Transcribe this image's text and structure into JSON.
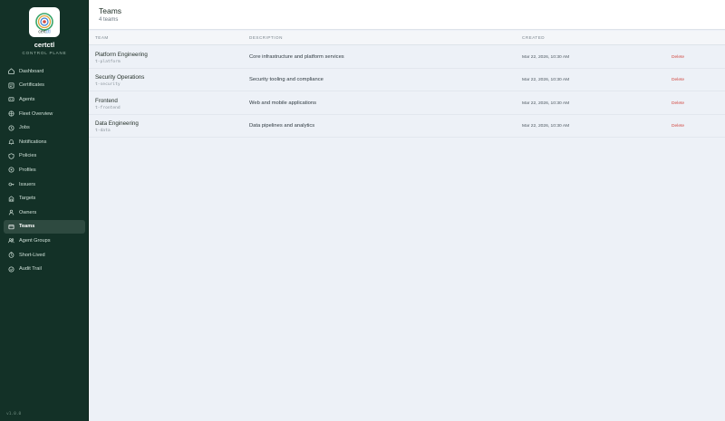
{
  "app": {
    "name": "certctl",
    "subtitle": "CONTROL PLANE",
    "logo_text": "cert",
    "logo_text_accent": "ctl",
    "version": "v1.0.0"
  },
  "sidebar": {
    "items": [
      {
        "label": "Dashboard",
        "icon": "home-icon",
        "active": false
      },
      {
        "label": "Certificates",
        "icon": "certificate-icon",
        "active": false
      },
      {
        "label": "Agents",
        "icon": "agent-icon",
        "active": false
      },
      {
        "label": "Fleet Overview",
        "icon": "fleet-icon",
        "active": false
      },
      {
        "label": "Jobs",
        "icon": "jobs-icon",
        "active": false
      },
      {
        "label": "Notifications",
        "icon": "bell-icon",
        "active": false
      },
      {
        "label": "Policies",
        "icon": "policy-icon",
        "active": false
      },
      {
        "label": "Profiles",
        "icon": "profile-icon",
        "active": false
      },
      {
        "label": "Issuers",
        "icon": "key-icon",
        "active": false
      },
      {
        "label": "Targets",
        "icon": "target-icon",
        "active": false
      },
      {
        "label": "Owners",
        "icon": "user-icon",
        "active": false
      },
      {
        "label": "Teams",
        "icon": "team-icon",
        "active": true
      },
      {
        "label": "Agent Groups",
        "icon": "group-icon",
        "active": false
      },
      {
        "label": "Short-Lived",
        "icon": "clock-icon",
        "active": false
      },
      {
        "label": "Audit Trail",
        "icon": "audit-icon",
        "active": false
      }
    ]
  },
  "header": {
    "title": "Teams",
    "subtitle": "4 teams"
  },
  "table": {
    "columns": [
      "TEAM",
      "DESCRIPTION",
      "CREATED"
    ],
    "delete_label": "Delete",
    "rows": [
      {
        "name": "Platform Engineering",
        "id": "t-platform",
        "description": "Core infrastructure and platform services",
        "created": "Mar 22, 2026, 10:30 AM"
      },
      {
        "name": "Security Operations",
        "id": "t-security",
        "description": "Security tooling and compliance",
        "created": "Mar 22, 2026, 10:30 AM"
      },
      {
        "name": "Frontend",
        "id": "t-frontend",
        "description": "Web and mobile applications",
        "created": "Mar 22, 2026, 10:30 AM"
      },
      {
        "name": "Data Engineering",
        "id": "t-data",
        "description": "Data pipelines and analytics",
        "created": "Mar 22, 2026, 10:30 AM"
      }
    ]
  },
  "colors": {
    "sidebar_bg": "#133127",
    "active_item_bg": "#2e4a40",
    "delete_red": "#d24b44",
    "main_bg": "#edf1f7"
  }
}
